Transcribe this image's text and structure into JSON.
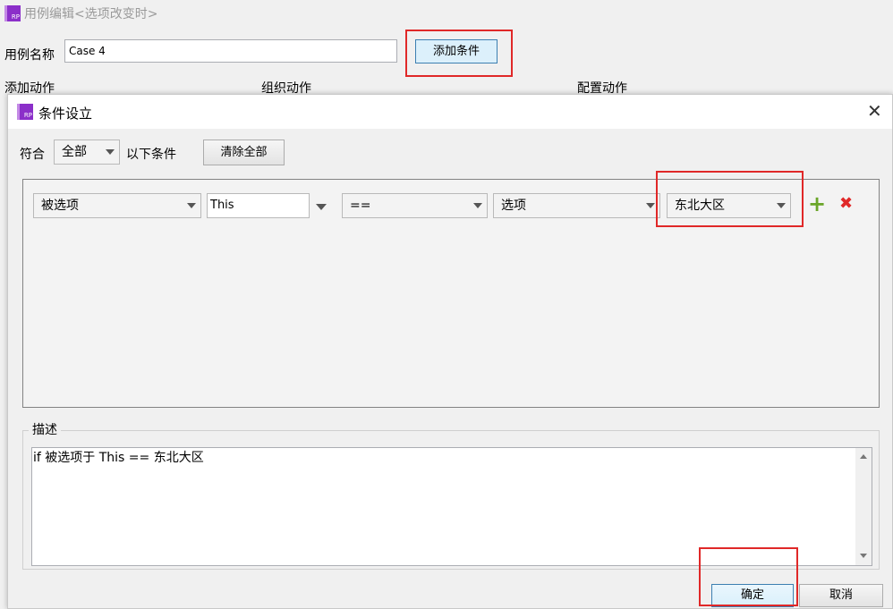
{
  "outer_window": {
    "title": "用例编辑<选项改变时>",
    "case_name_label": "用例名称",
    "case_name_value": "Case 4",
    "add_condition_button": "添加条件",
    "columns": [
      "添加动作",
      "组织动作",
      "配置动作"
    ]
  },
  "dialog": {
    "title": "条件设立",
    "match_label": "符合",
    "match_select": "全部",
    "following_label": "以下条件",
    "clear_all_button": "清除全部",
    "condition_row": {
      "field1": "被选项",
      "field2": "This",
      "operator": "==",
      "field3": "选项",
      "value": "东北大区"
    },
    "description_label": "描述",
    "description_text": "if 被选项于 This == 东北大区",
    "ok_button": "确定",
    "cancel_button": "取消"
  },
  "colors": {
    "highlight_red": "#e02828",
    "add_icon_green": "#6aa529",
    "delete_icon_red": "#e02828",
    "logo_purple": "#8b2fc9"
  },
  "icons": [
    "axure-rp-logo-icon",
    "close-icon",
    "add-icon",
    "delete-icon",
    "dropdown-arrow-icon",
    "scroll-up-icon",
    "scroll-down-icon"
  ]
}
